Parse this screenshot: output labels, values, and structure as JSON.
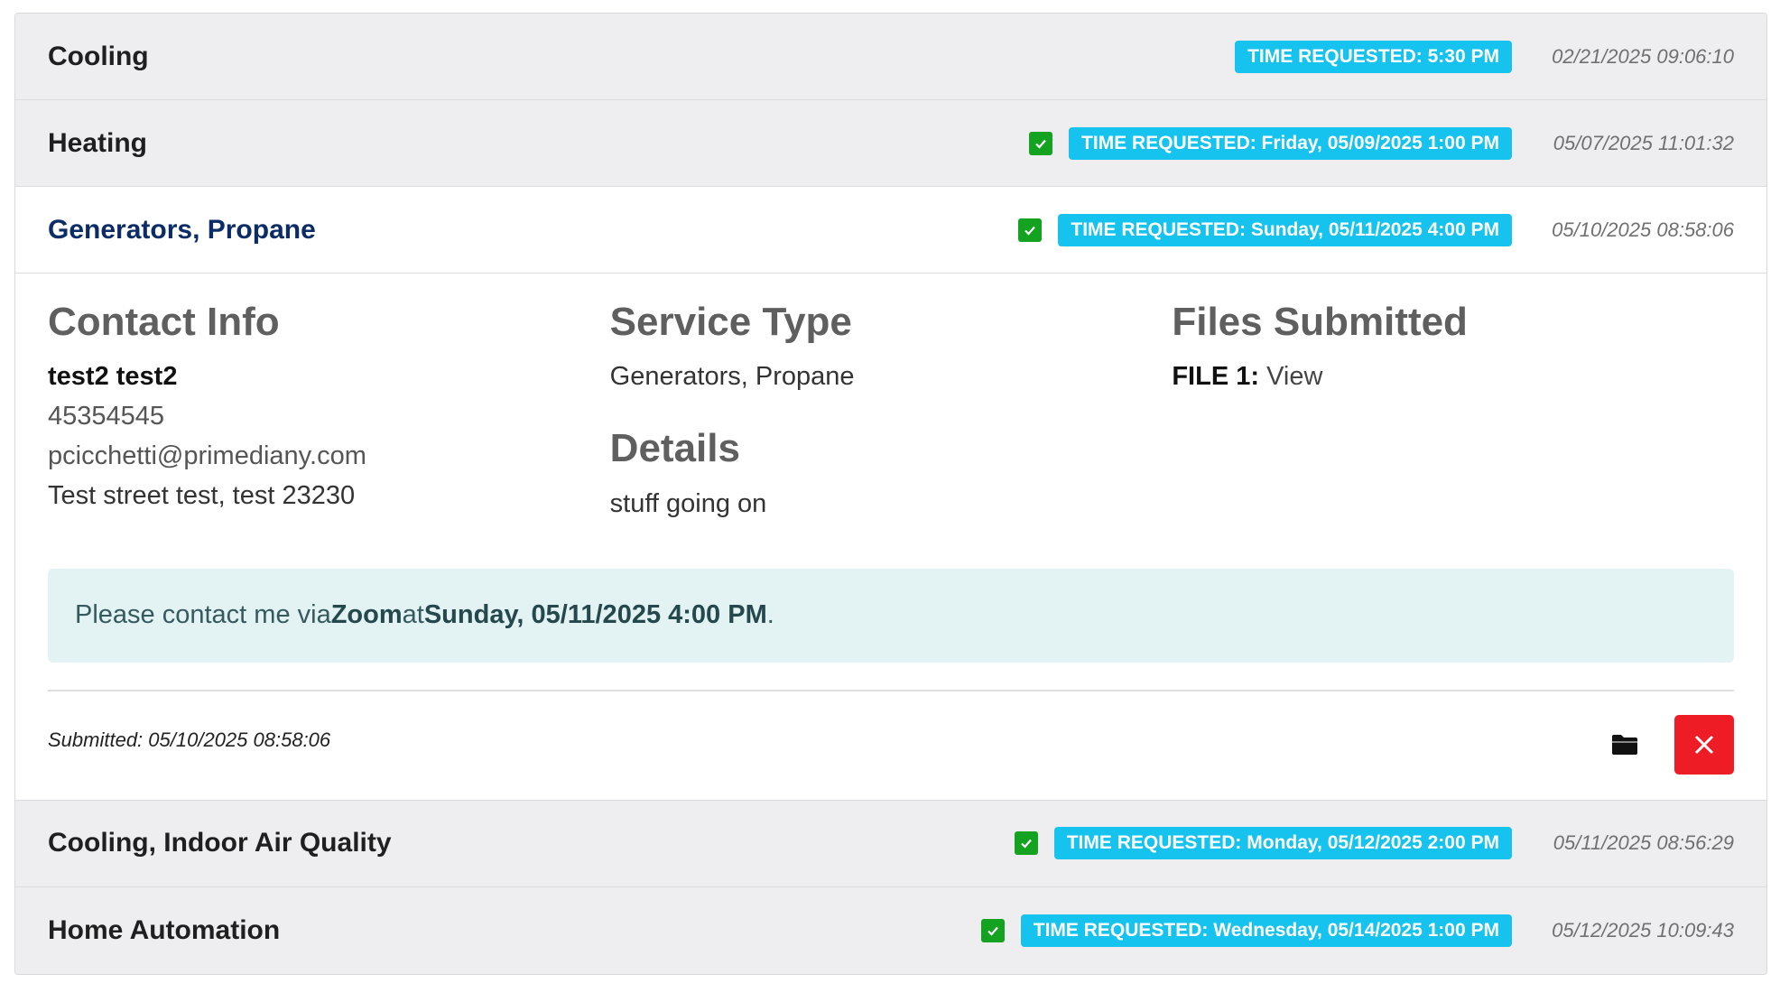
{
  "requests": [
    {
      "title": "Cooling",
      "checked": false,
      "time_requested": "TIME REQUESTED: 5:30 PM",
      "timestamp": "02/21/2025 09:06:10"
    },
    {
      "title": "Heating",
      "checked": true,
      "time_requested": "TIME REQUESTED: Friday, 05/09/2025 1:00 PM",
      "timestamp": "05/07/2025 11:01:32"
    },
    {
      "title": "Generators, Propane",
      "checked": true,
      "time_requested": "TIME REQUESTED: Sunday, 05/11/2025 4:00 PM",
      "timestamp": "05/10/2025 08:58:06"
    },
    {
      "title": "Cooling, Indoor Air Quality",
      "checked": true,
      "time_requested": "TIME REQUESTED: Monday, 05/12/2025 2:00 PM",
      "timestamp": "05/11/2025 08:56:29"
    },
    {
      "title": "Home Automation",
      "checked": true,
      "time_requested": "TIME REQUESTED: Wednesday, 05/14/2025 1:00 PM",
      "timestamp": "05/12/2025 10:09:43"
    }
  ],
  "details": {
    "contact_heading": "Contact Info",
    "contact_name": "test2 test2",
    "contact_phone": "45354545",
    "contact_email": "pcicchetti@primediany.com",
    "contact_address": "Test street test, test 23230",
    "service_heading": "Service Type",
    "service_value": "Generators, Propane",
    "details_heading": "Details",
    "details_value": "stuff going on",
    "files_heading": "Files Submitted",
    "file1_label": "FILE 1:",
    "file1_link": "View",
    "notice_prefix": "Please contact me via ",
    "notice_method": "Zoom",
    "notice_mid": " at ",
    "notice_time": "Sunday, 05/11/2025 4:00 PM",
    "notice_suffix": ".",
    "submitted_label": "Submitted:",
    "submitted_value": "05/10/2025 08:58:06"
  },
  "icons": {
    "check": "check-icon",
    "folder": "folder-icon",
    "delete": "close-icon"
  },
  "colors": {
    "badge": "#16c2ee",
    "check": "#14a320",
    "delete": "#ee1c25",
    "active_title": "#0b2c66",
    "notice_bg": "#e3f2f3"
  }
}
